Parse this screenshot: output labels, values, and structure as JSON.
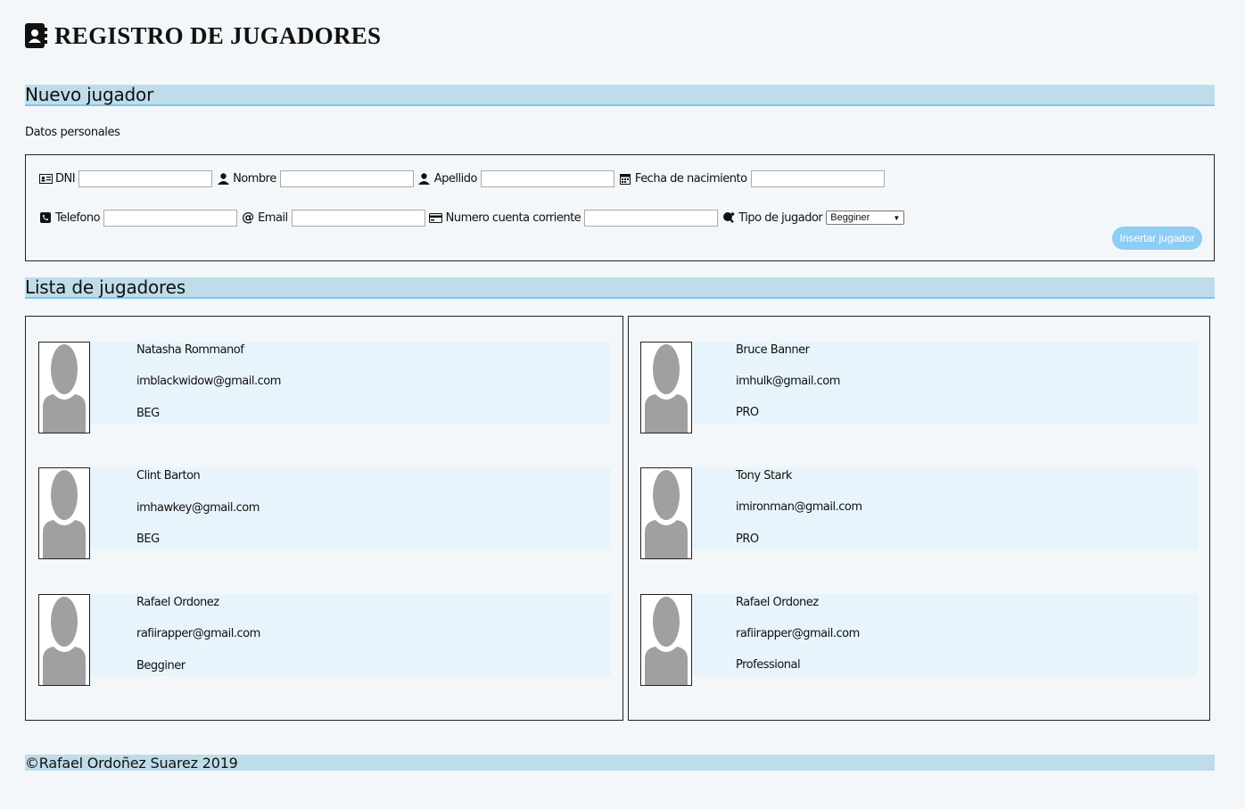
{
  "header": {
    "title": "REGISTRO DE JUGADORES",
    "icon": "address-book-icon"
  },
  "new_player": {
    "heading": "Nuevo jugador",
    "subtitle": "Datos personales",
    "fields": {
      "dni": {
        "label": "DNI",
        "value": "",
        "icon": "id-card-icon"
      },
      "nombre": {
        "label": "Nombre",
        "value": "",
        "icon": "user-icon"
      },
      "apellido": {
        "label": "Apellido",
        "value": "",
        "icon": "user-icon"
      },
      "fecha": {
        "label": "Fecha de nacimiento",
        "value": "",
        "icon": "calendar-icon"
      },
      "telefono": {
        "label": "Telefono",
        "value": "",
        "icon": "phone-icon"
      },
      "email": {
        "label": "Email",
        "value": "",
        "icon": "at-icon"
      },
      "cuenta": {
        "label": "Numero cuenta corriente",
        "value": "",
        "icon": "credit-card-icon"
      },
      "tipo": {
        "label": "Tipo de jugador",
        "selected": "Begginer",
        "icon": "ping-pong-icon"
      }
    },
    "submit_label": "Insertar jugador"
  },
  "player_list": {
    "heading": "Lista de jugadores",
    "left": [
      {
        "name": "Natasha Rommanof",
        "email": "imblackwidow@gmail.com",
        "level": "BEG"
      },
      {
        "name": "Clint Barton",
        "email": "imhawkey@gmail.com",
        "level": "BEG"
      },
      {
        "name": "Rafael Ordonez",
        "email": "rafiirapper@gmail.com",
        "level": "Begginer"
      }
    ],
    "right": [
      {
        "name": "Bruce Banner",
        "email": "imhulk@gmail.com",
        "level": "PRO"
      },
      {
        "name": "Tony Stark",
        "email": "imironman@gmail.com",
        "level": "PRO"
      },
      {
        "name": "Rafael Ordonez",
        "email": "rafiirapper@gmail.com",
        "level": "Professional"
      }
    ]
  },
  "footer": {
    "text": "©Rafael Ordoñez Suarez 2019"
  },
  "colors": {
    "section_bar": "#bfdcea",
    "section_underline": "#7ec6ef",
    "card_bg": "#e8f4fc",
    "button": "#8ecdf4",
    "page_bg": "#f3f7f9"
  }
}
